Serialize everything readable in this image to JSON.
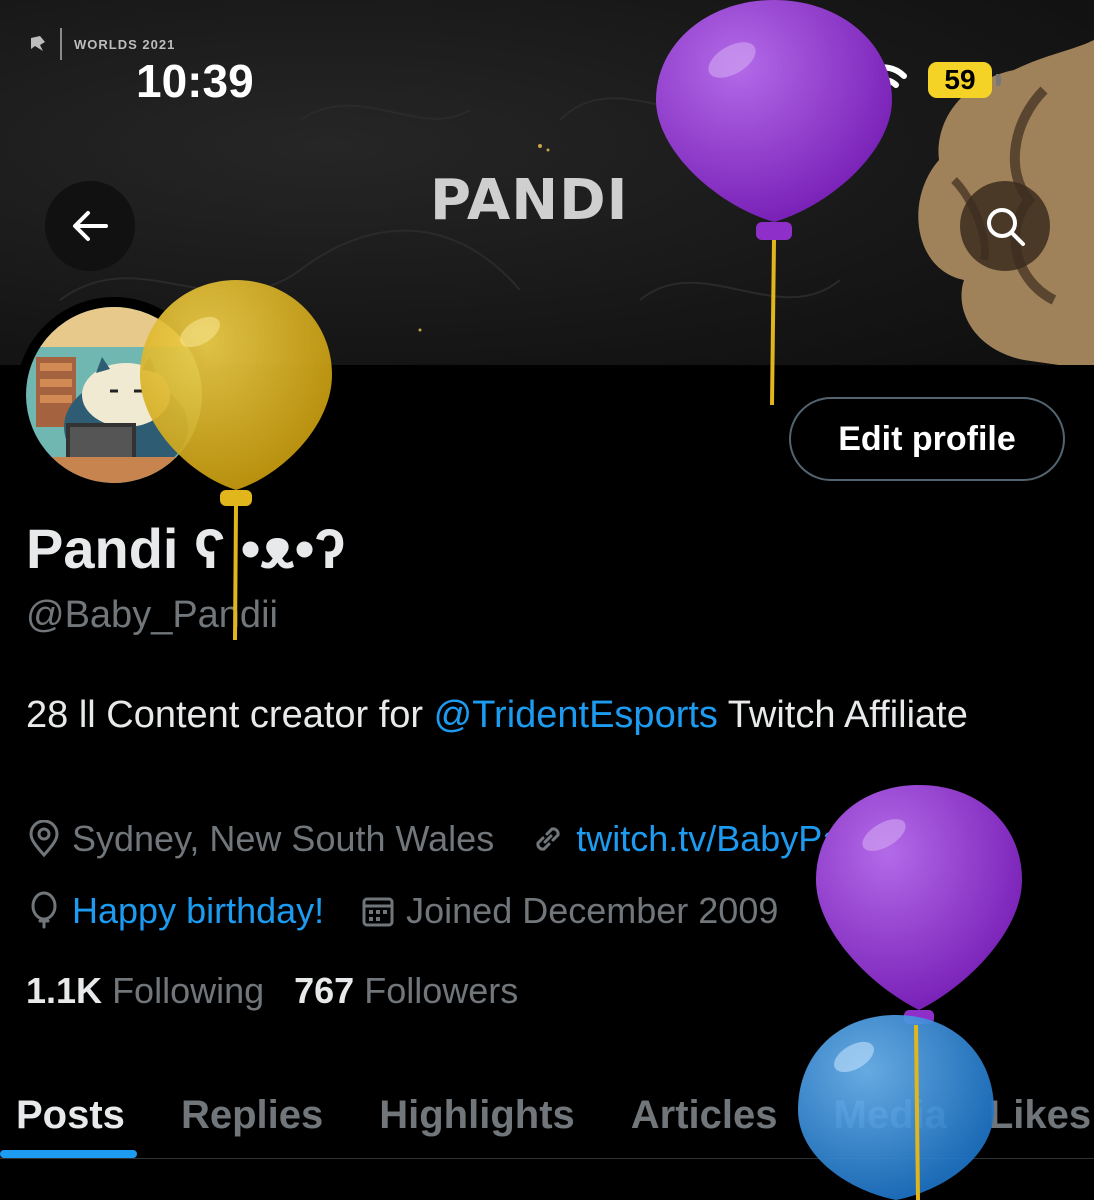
{
  "status_bar": {
    "event_label": "WORLDS 2021",
    "time": "10:39",
    "battery": "59",
    "signal_bars": 4,
    "signal_bars_active": 3
  },
  "banner": {
    "title": "PANDI"
  },
  "profile": {
    "display_name": "Pandi ʕ •ᴥ•ʔ",
    "handle": "@Baby_Pandii",
    "edit_button_label": "Edit profile",
    "bio_prefix": "28 ll Content creator for ",
    "bio_mention": "@TridentEsports",
    "bio_suffix": " Twitch Affiliate",
    "location": "Sydney, New South Wales",
    "website": "twitch.tv/BabyPandii",
    "birthday": "Happy birthday!",
    "joined": "Joined December 2009",
    "following_count": "1.1K",
    "following_label": "Following",
    "followers_count": "767",
    "followers_label": "Followers"
  },
  "tabs": [
    "Posts",
    "Replies",
    "Highlights",
    "Articles",
    "Media",
    "Likes"
  ],
  "active_tab": "Posts",
  "colors": {
    "accent": "#1d9bf0",
    "background": "#000000",
    "secondary_text": "#71767b",
    "battery": "#f5d326",
    "balloon_purple": "#8e2fc9",
    "balloon_yellow": "#e0b61c",
    "balloon_blue": "#2b8de0"
  }
}
